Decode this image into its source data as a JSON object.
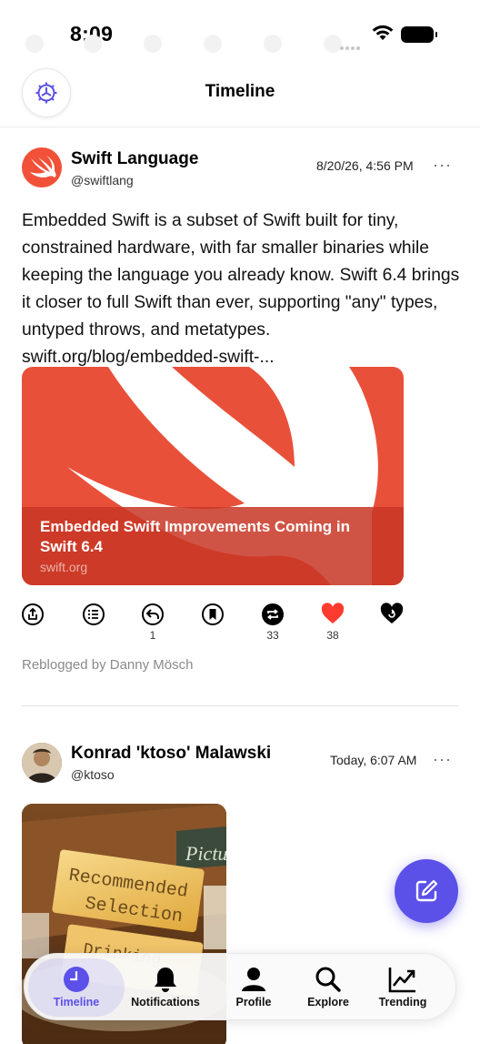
{
  "status_bar": {
    "time": "8:09"
  },
  "nav": {
    "title": "Timeline",
    "settings_icon": "gear-icon"
  },
  "posts": [
    {
      "author": "Swift Language",
      "handle": "@swiftlang",
      "date": "8/20/26, 4:56 PM",
      "more_label": "···",
      "text": "Embedded Swift is a subset of Swift built for tiny, constrained hardware, with far smaller binaries while keeping the language you already know. Swift 6.4 brings it closer to full Swift than ever, supporting \"any\" types, untyped throws, and metatypes. swift.org/blog/embedded-swift-...",
      "card": {
        "title": "Embedded Swift Improvements Coming in Swift 6.4",
        "domain": "swift.org",
        "accent": "#e9503a"
      },
      "actions": {
        "reply_count": "1",
        "boost_count": "33",
        "favorite_count": "38"
      },
      "reblogged_by": "Reblogged by Danny Mösch"
    },
    {
      "author": "Konrad 'ktoso' Malawski",
      "handle": "@ktoso",
      "date": "Today, 6:07 AM",
      "more_label": "···",
      "photo_lines": [
        "Recommended",
        "Selection",
        "Drinking",
        "Pictu"
      ]
    }
  ],
  "tabs": [
    {
      "label": "Timeline",
      "icon": "clock-icon",
      "active": true
    },
    {
      "label": "Notifications",
      "icon": "bell-icon",
      "active": false
    },
    {
      "label": "Profile",
      "icon": "person-icon",
      "active": false
    },
    {
      "label": "Explore",
      "icon": "search-icon",
      "active": false
    },
    {
      "label": "Trending",
      "icon": "chart-trending-icon",
      "active": false
    }
  ],
  "colors": {
    "accent": "#5b50e8",
    "heart": "#ff3b30",
    "card": "#e9503a"
  }
}
